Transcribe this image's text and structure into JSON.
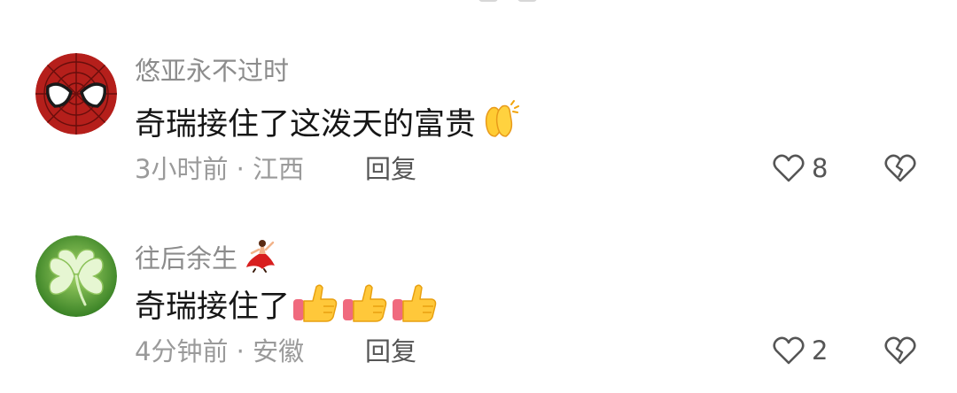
{
  "comments": [
    {
      "username": "悠亚永不过时",
      "text": "奇瑞接住了这泼天的富贵",
      "emoji": [
        "clapping-hands-icon"
      ],
      "time": "3小时前",
      "location": "江西",
      "meta_separator": " · ",
      "reply_label": "回复",
      "likes": "8",
      "avatar": "spider-mask-icon"
    },
    {
      "username": "往后余生",
      "username_badge": "flamenco-dancer-icon",
      "text": "奇瑞接住了",
      "emoji": [
        "thumbs-up-icon",
        "thumbs-up-icon",
        "thumbs-up-icon"
      ],
      "time": "4分钟前",
      "location": "安徽",
      "meta_separator": " · ",
      "reply_label": "回复",
      "likes": "2",
      "avatar": "clover-icon"
    }
  ],
  "icons": {
    "like": "heart-outline-icon",
    "dislike": "broken-heart-outline-icon"
  },
  "colors": {
    "username": "#8c8c8c",
    "body_text": "#161616",
    "meta_text": "#9a9a9a",
    "action_text": "#555555"
  }
}
